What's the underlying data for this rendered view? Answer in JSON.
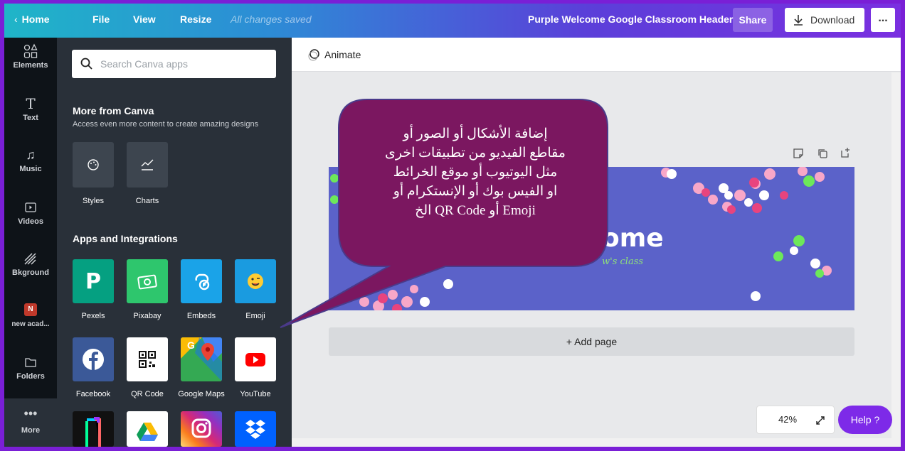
{
  "topbar": {
    "home_label": "Home",
    "file_label": "File",
    "view_label": "View",
    "resize_label": "Resize",
    "saved_status": "All changes saved",
    "document_title": "Purple Welcome Google Classroom Header",
    "share_label": "Share",
    "download_label": "Download",
    "more_label": "..."
  },
  "rail": {
    "items": [
      {
        "label": "Elements",
        "icon": "elements-icon"
      },
      {
        "label": "Text",
        "icon": "text-icon"
      },
      {
        "label": "Music",
        "icon": "music-icon"
      },
      {
        "label": "Videos",
        "icon": "videos-icon"
      },
      {
        "label": "Bkground",
        "icon": "background-icon"
      },
      {
        "label": "new acad...",
        "icon": "folder-avatar-icon",
        "badge": "N"
      },
      {
        "label": "Folders",
        "icon": "folder-icon"
      },
      {
        "label": "More",
        "icon": "more-dots-icon"
      }
    ]
  },
  "panel": {
    "search_placeholder": "Search Canva apps",
    "more_title": "More from Canva",
    "more_subtitle": "Access even more content to create amazing designs",
    "more_tiles": [
      {
        "label": "Styles",
        "icon": "palette-icon"
      },
      {
        "label": "Charts",
        "icon": "chart-icon"
      }
    ],
    "apps_title": "Apps and Integrations",
    "apps": [
      {
        "label": "Pexels",
        "icon": "pexels-icon",
        "color": "#05a081"
      },
      {
        "label": "Pixabay",
        "icon": "pixabay-icon",
        "color": "#2ec66d"
      },
      {
        "label": "Embeds",
        "icon": "embeds-icon",
        "color": "#1aa3e8"
      },
      {
        "label": "Emoji",
        "icon": "emoji-icon",
        "color": "#1a9be0"
      },
      {
        "label": "Facebook",
        "icon": "facebook-icon",
        "color": "#3b5998"
      },
      {
        "label": "QR Code",
        "icon": "qr-code-icon",
        "color": "#ffffff"
      },
      {
        "label": "Google Maps",
        "icon": "google-maps-icon",
        "color": "#34a853"
      },
      {
        "label": "YouTube",
        "icon": "youtube-icon",
        "color": "#ffffff"
      }
    ]
  },
  "canvas": {
    "animate_label": "Animate",
    "add_page_label": "+ Add page",
    "design_text_partial": "ome",
    "design_subtext_partial": "w's class",
    "zoom_level": "42%",
    "help_label": "Help ?"
  },
  "callout": {
    "lines": [
      "إضافة الأشكال أو الصور أو",
      "مقاطع الفيديو من تطبيقات اخرى",
      "مثل اليوتيوب  أو موقع الخرائط",
      "او الفيس بوك أو الإنستكرام  أو",
      "Emoji أو  QR Code الخ"
    ],
    "bubble_color": "#7b1760"
  }
}
